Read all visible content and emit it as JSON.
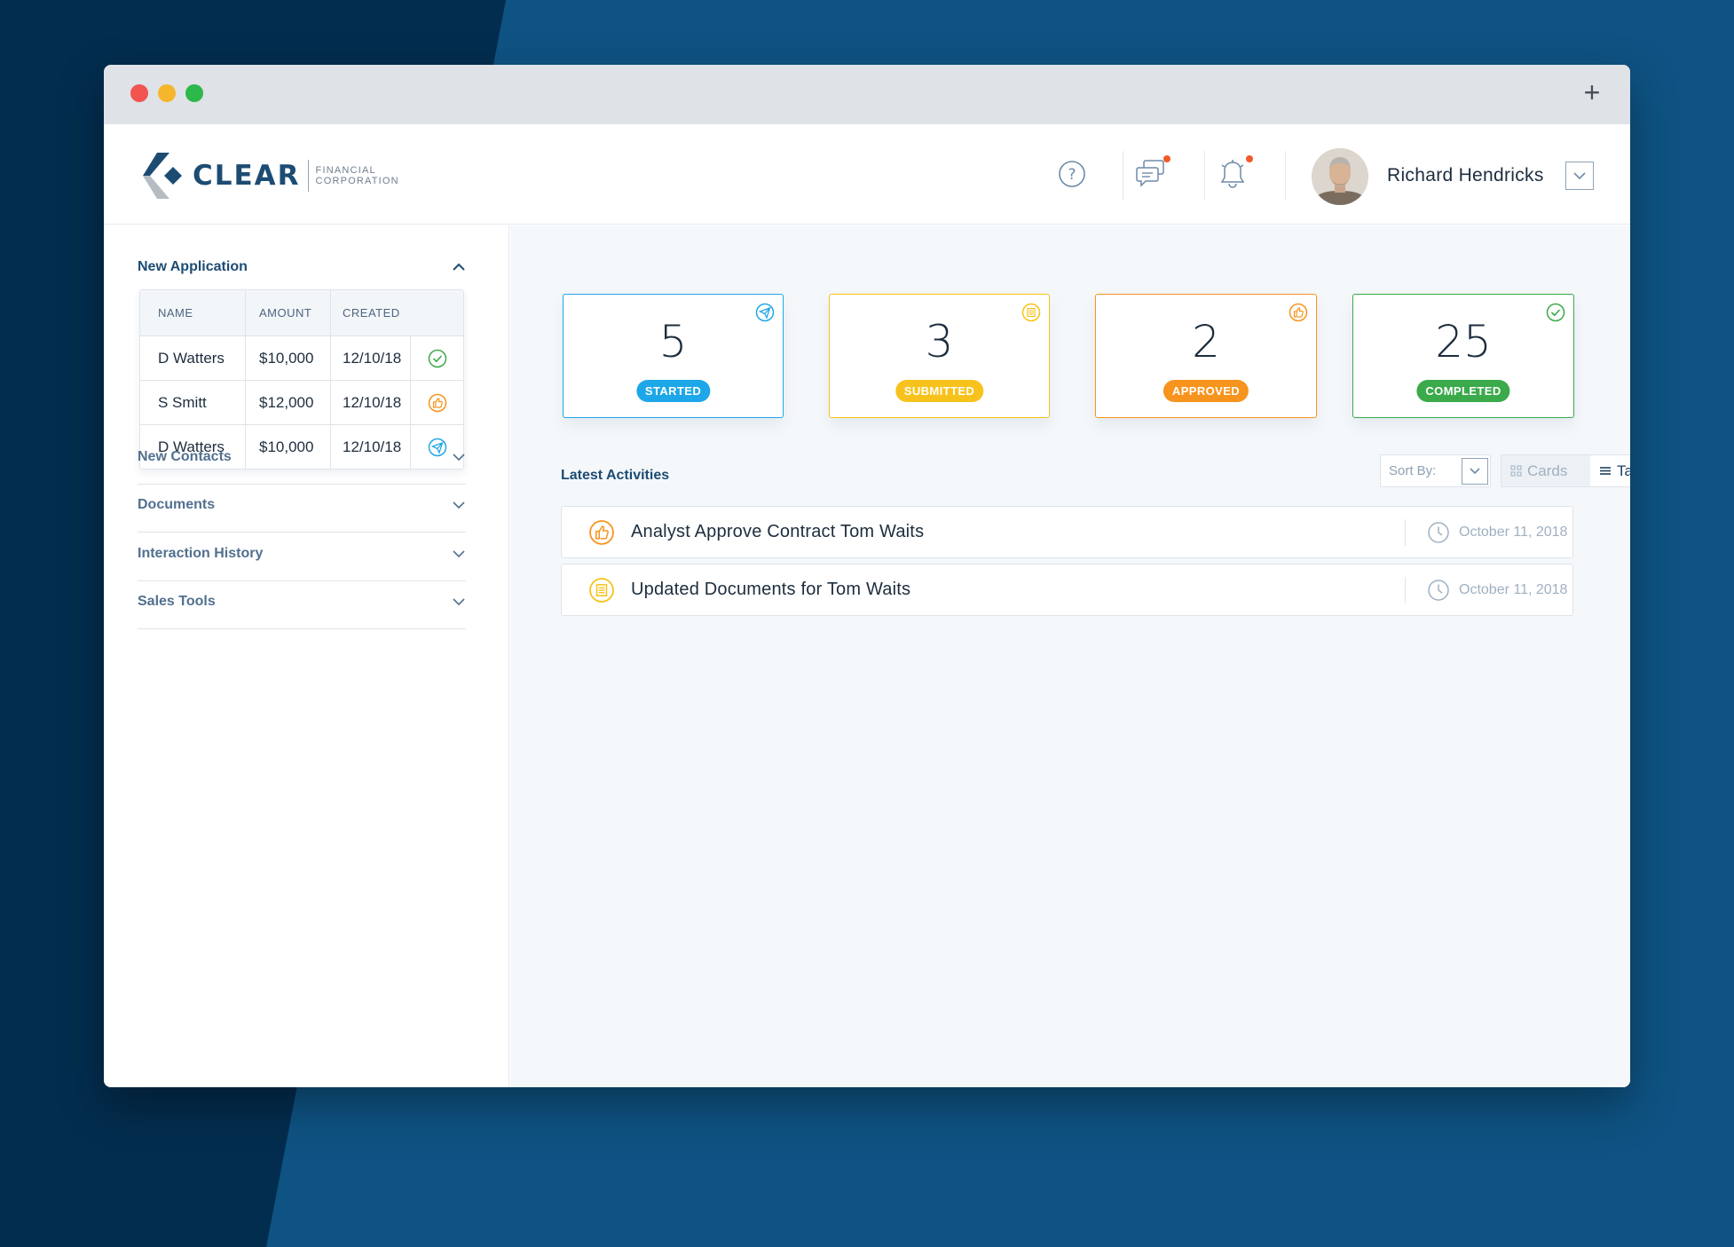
{
  "app": {
    "logo_word": "CLEAR",
    "logo_sub_1": "FINANCIAL",
    "logo_sub_2": "CORPORATION"
  },
  "header": {
    "help_icon": "help-circle-icon",
    "messages_icon": "chat-bubbles-icon",
    "alerts_icon": "bell-icon",
    "user_name": "Richard Hendricks",
    "notification_color": "#f05a28"
  },
  "sidebar": {
    "new_application": {
      "title": "New Application",
      "columns": [
        "NAME",
        "AMOUNT",
        "CREATED"
      ],
      "rows": [
        {
          "name": "D Watters",
          "amount": "$10,000",
          "created": "12/10/18",
          "status_icon": "check-circle-icon"
        },
        {
          "name": "S Smitt",
          "amount": "$12,000",
          "created": "12/10/18",
          "status_icon": "thumbs-up-icon"
        },
        {
          "name": "D Watters",
          "amount": "$10,000",
          "created": "12/10/18",
          "status_icon": "paper-plane-icon"
        }
      ]
    },
    "sections": [
      {
        "label": "New Contacts"
      },
      {
        "label": "Documents"
      },
      {
        "label": "Interaction History"
      },
      {
        "label": "Sales Tools"
      }
    ]
  },
  "stats": [
    {
      "value": "5",
      "label": "STARTED",
      "color": "#1ea7e8",
      "icon": "paper-plane-icon"
    },
    {
      "value": "3",
      "label": "SUBMITTED",
      "color": "#f7c21b",
      "icon": "document-icon"
    },
    {
      "value": "2",
      "label": "APPROVED",
      "color": "#f7941d",
      "icon": "thumbs-up-icon"
    },
    {
      "value": "25",
      "label": "COMPLETED",
      "color": "#3aaa4a",
      "icon": "check-circle-icon"
    }
  ],
  "activities": {
    "title": "Latest Activities",
    "sort_label": "Sort By:",
    "view_cards": "Cards",
    "view_table": "Table",
    "items": [
      {
        "text": "Analyst Approve Contract Tom Waits",
        "date": "October 11, 2018",
        "icon": "thumbs-up-icon"
      },
      {
        "text": "Updated Documents for Tom Waits",
        "date": "October 11, 2018",
        "icon": "document-icon"
      }
    ]
  }
}
